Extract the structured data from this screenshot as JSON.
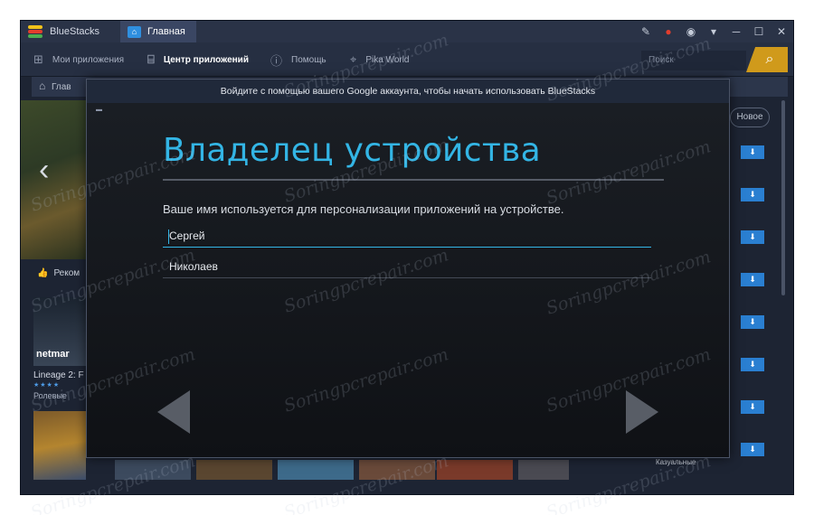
{
  "titlebar": {
    "app_name": "BlueStacks",
    "tab_label": "Главная",
    "icons": [
      "pin-icon",
      "bell-icon",
      "account-icon",
      "menu-chevron-icon",
      "minimize-icon",
      "maximize-icon",
      "close-icon"
    ]
  },
  "navbar": {
    "items": [
      {
        "label": "Мои приложения",
        "icon": "grid-icon"
      },
      {
        "label": "Центр приложений",
        "icon": "bag-icon"
      },
      {
        "label": "Помощь",
        "icon": "help-icon"
      },
      {
        "label": "Pika World",
        "icon": "location-icon"
      }
    ],
    "active_index": 1,
    "search_placeholder": "Поиск"
  },
  "breadcrumb": {
    "label": "Глав"
  },
  "background": {
    "recommended_label": "Реком",
    "game_brand": "netmar",
    "game_name": "Lineage 2: F",
    "game_genre": "Ролевые",
    "new_button": "Новое",
    "casual_label": "Казуальные"
  },
  "dialog": {
    "header": "Войдите с помощью вашего Google аккаунта, чтобы начать использовать BlueStacks",
    "title": "Владелец устройства",
    "description": "Ваше имя используется для персонализации приложений на устройстве.",
    "first_name": "Сергей",
    "last_name": "Николаев"
  },
  "watermark": "Soringpcrepair.com",
  "colors": {
    "accent": "#33b5e5",
    "search_button": "#d09a1b",
    "download_button": "#2a7fd1"
  }
}
